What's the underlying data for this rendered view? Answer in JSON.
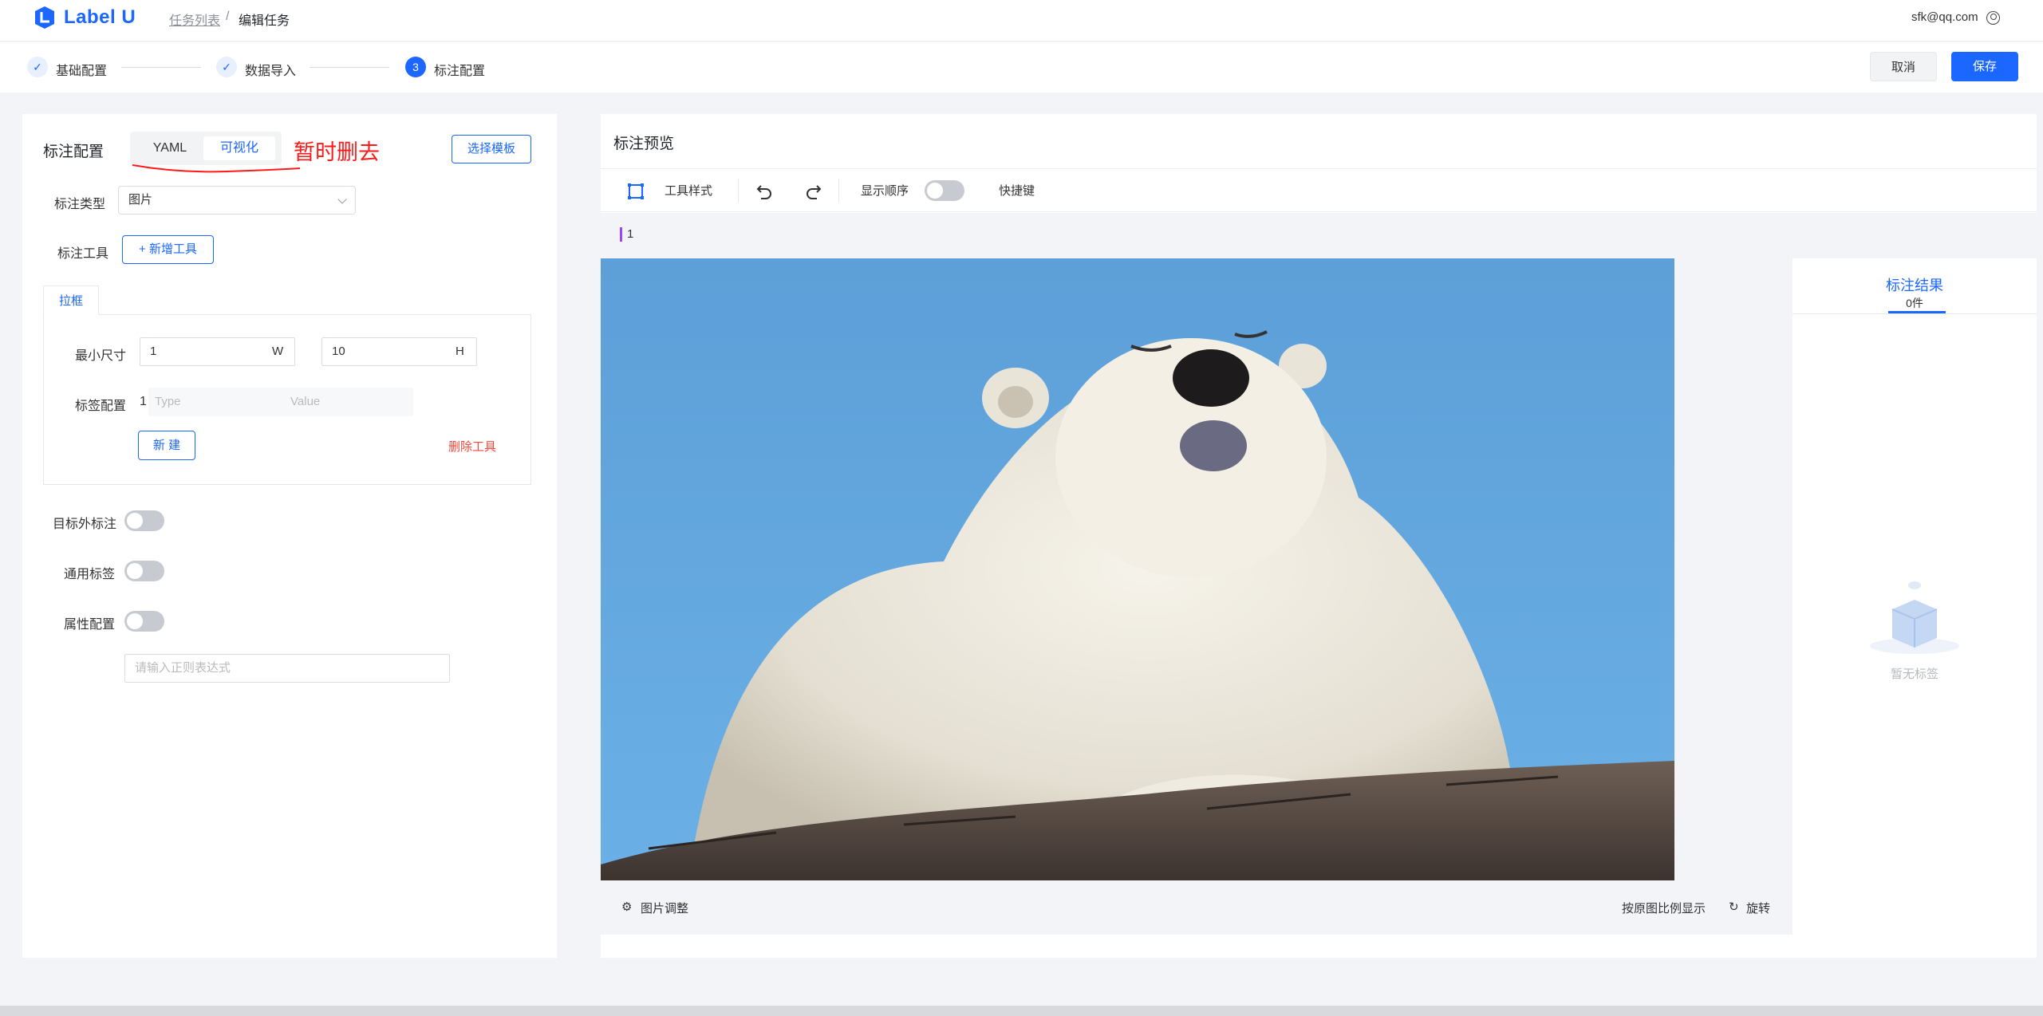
{
  "header": {
    "logo_text": "Label U",
    "breadcrumb": [
      "任务列表",
      "/",
      "编辑任务"
    ],
    "user_email": "sfk@qq.com"
  },
  "steps": [
    {
      "number": "1",
      "label": "基础配置",
      "state": "done"
    },
    {
      "number": "2",
      "label": "数据导入",
      "state": "done"
    },
    {
      "number": "3",
      "label": "标注配置",
      "state": "current"
    }
  ],
  "actions": {
    "cancel": "取消",
    "save": "保存"
  },
  "config": {
    "title": "标注配置",
    "modes": [
      "YAML",
      "可视化"
    ],
    "active_mode": "可视化",
    "note": "暂时删去",
    "template_button": "选择模板",
    "type_label": "标注类型",
    "type_value": "图片",
    "tool_label": "标注工具",
    "add_tool_button": "+ 新增工具",
    "tool_tab": "拉框",
    "min_size_label": "最小尺寸",
    "min_w": "1",
    "w_suffix": "W",
    "min_h": "10",
    "h_suffix": "H",
    "tag_label": "标签配置",
    "tag_index": "1",
    "tag_type_placeholder": "Type",
    "tag_value_placeholder": "Value",
    "new_button": "新 建",
    "delete_tool": "删除工具",
    "outside_label": "目标外标注",
    "common_tag_label": "通用标签",
    "attr_label": "属性配置",
    "regex_placeholder": "请输入正则表达式"
  },
  "preview": {
    "title": "标注预览",
    "tool_style": "工具样式",
    "show_order": "显示顺序",
    "shortcut": "快捷键",
    "annotation_index": "1",
    "image_adjust": "图片调整",
    "original_ratio": "按原图比例显示",
    "rotate": "旋转",
    "results_title": "标注结果",
    "results_count": "0件",
    "empty_text": "暂无标签"
  },
  "colors": {
    "accent": "#1b67ff",
    "note_red": "#ff1a1a",
    "delete_red": "#f5483b"
  }
}
